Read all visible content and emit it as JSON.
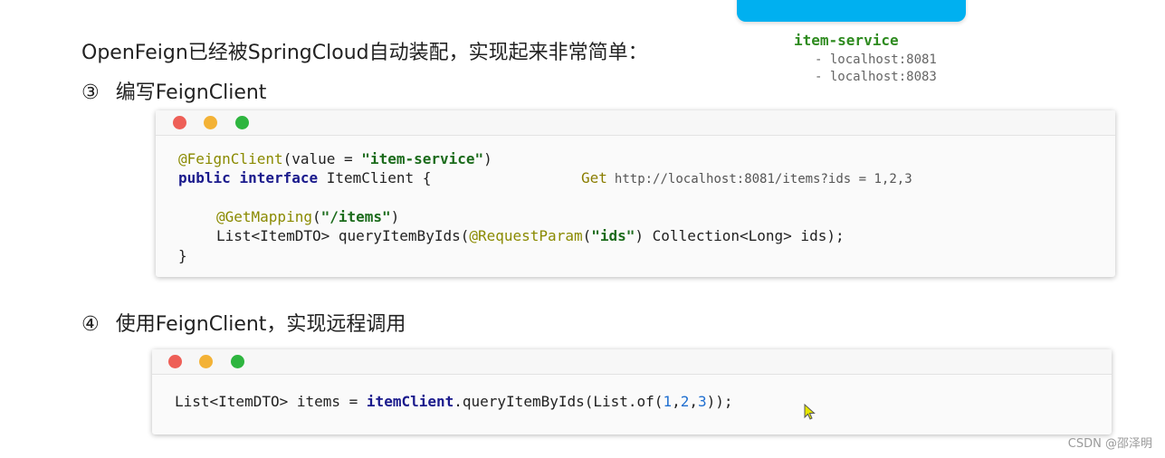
{
  "service": {
    "name": "item-service",
    "instances": [
      "- localhost:8081",
      "- localhost:8083"
    ]
  },
  "intro": "OpenFeign已经被SpringCloud自动装配，实现起来非常简单：",
  "step3": {
    "num": "③",
    "label": "编写FeignClient"
  },
  "step4": {
    "num": "④",
    "label": "使用FeignClient，实现远程调用"
  },
  "code1": {
    "l1_anno": "@FeignClient",
    "l1_open": "(value = ",
    "l1_str": "\"item-service\"",
    "l1_close": ")",
    "l2_kw1": "public",
    "l2_kw2": "interface",
    "l2_rest": " ItemClient {",
    "l4_anno": "@GetMapping",
    "l4_open": "(",
    "l4_str": "\"/items\"",
    "l4_close": ")",
    "l5_a": "List<ItemDTO> queryItemByIds(",
    "l5_anno": "@RequestParam",
    "l5_open": "(",
    "l5_str": "\"ids\"",
    "l5_rest": ") Collection<Long> ids);",
    "l6": "}"
  },
  "side_note": {
    "method": "Get",
    "url": "http://localhost:8081/items?ids = 1,2,3"
  },
  "code2": {
    "a": "List<ItemDTO> items = ",
    "call": "itemClient",
    "b": ".queryItemByIds(List.of(",
    "n1": "1",
    "c1": ",",
    "n2": "2",
    "c2": ",",
    "n3": "3",
    "end": "));"
  },
  "watermark": "CSDN @邵泽明",
  "icons": {
    "cursor": "mouse-cursor-icon"
  },
  "colors": {
    "accent_blue": "#00b0f0",
    "service_green": "#2e8b1f"
  }
}
